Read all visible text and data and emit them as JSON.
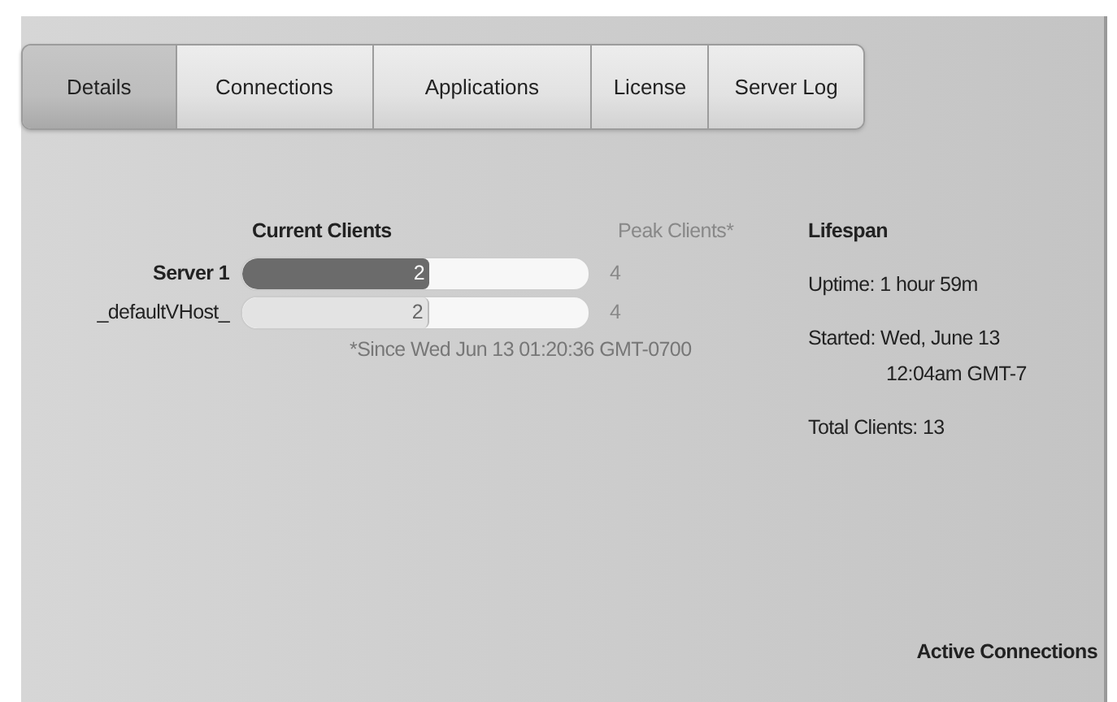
{
  "tabs": [
    {
      "label": "Details",
      "selected": true
    },
    {
      "label": "Connections",
      "selected": false
    },
    {
      "label": "Applications",
      "selected": false
    },
    {
      "label": "License",
      "selected": false
    },
    {
      "label": "Server Log",
      "selected": false
    }
  ],
  "clients": {
    "current_heading": "Current Clients",
    "peak_heading": "Peak Clients*",
    "rows": [
      {
        "kind": "server",
        "name": "Server 1",
        "current": "2",
        "level": 0.54,
        "peak": "4"
      },
      {
        "kind": "vhost",
        "name": "_defaultVHost_",
        "current": "2",
        "level": 0.54,
        "peak": "4"
      }
    ],
    "footnote": "*Since Wed Jun 13 01:20:36 GMT-0700"
  },
  "lifespan": {
    "heading": "Lifespan",
    "uptime": "Uptime: 1 hour 59m",
    "started_line_1": "Started: Wed, June 13",
    "started_line_2": "12:04am GMT-7",
    "total_clients": "Total Clients: 13"
  },
  "active_connections_heading": "Active Connections"
}
